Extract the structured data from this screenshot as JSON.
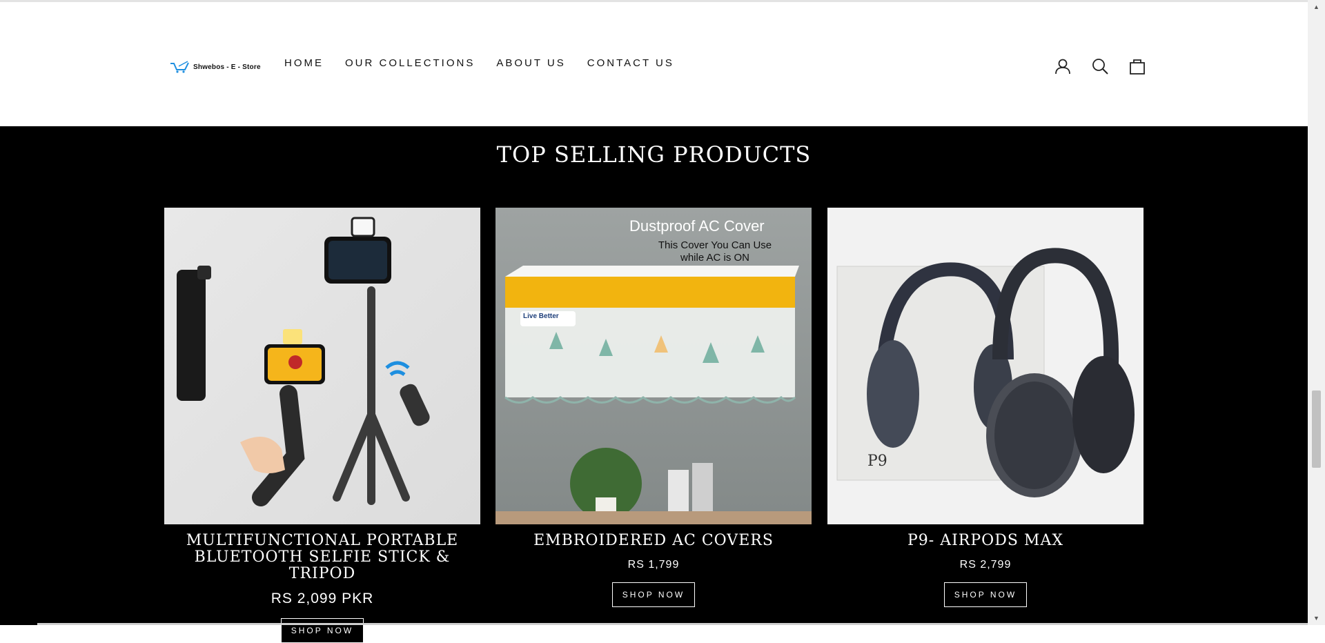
{
  "brand": {
    "name": "Shwebos - E - Store"
  },
  "nav": {
    "items": [
      {
        "label": "HOME"
      },
      {
        "label": "OUR COLLECTIONS"
      },
      {
        "label": "ABOUT US"
      },
      {
        "label": "CONTACT US"
      }
    ]
  },
  "header_icons": [
    "user-icon",
    "search-icon",
    "cart-icon"
  ],
  "section": {
    "title": "TOP SELLING PRODUCTS"
  },
  "products": [
    {
      "name": "MULTIFUNCTIONAL PORTABLE BLUETOOTH SELFIE STICK & TRIPOD",
      "price": "RS 2,099 PKR",
      "button": "SHOP NOW"
    },
    {
      "name": "EMBROIDERED AC COVERS",
      "price": "RS 1,799",
      "button": "SHOP NOW",
      "image_text": {
        "headline": "Dustproof AC Cover",
        "line1": "This Cover You Can Use",
        "line2": "while AC is ON",
        "brand_badge": "Live Better"
      }
    },
    {
      "name": "P9- AIRPODS MAX",
      "price": "RS 2,799",
      "button": "SHOP NOW",
      "image_text": {
        "box_label": "P9"
      }
    }
  ],
  "colors": {
    "background": "#000000",
    "header": "#ffffff",
    "accent_yellow": "#f2b40f",
    "logo_blue": "#1e8fe0"
  }
}
